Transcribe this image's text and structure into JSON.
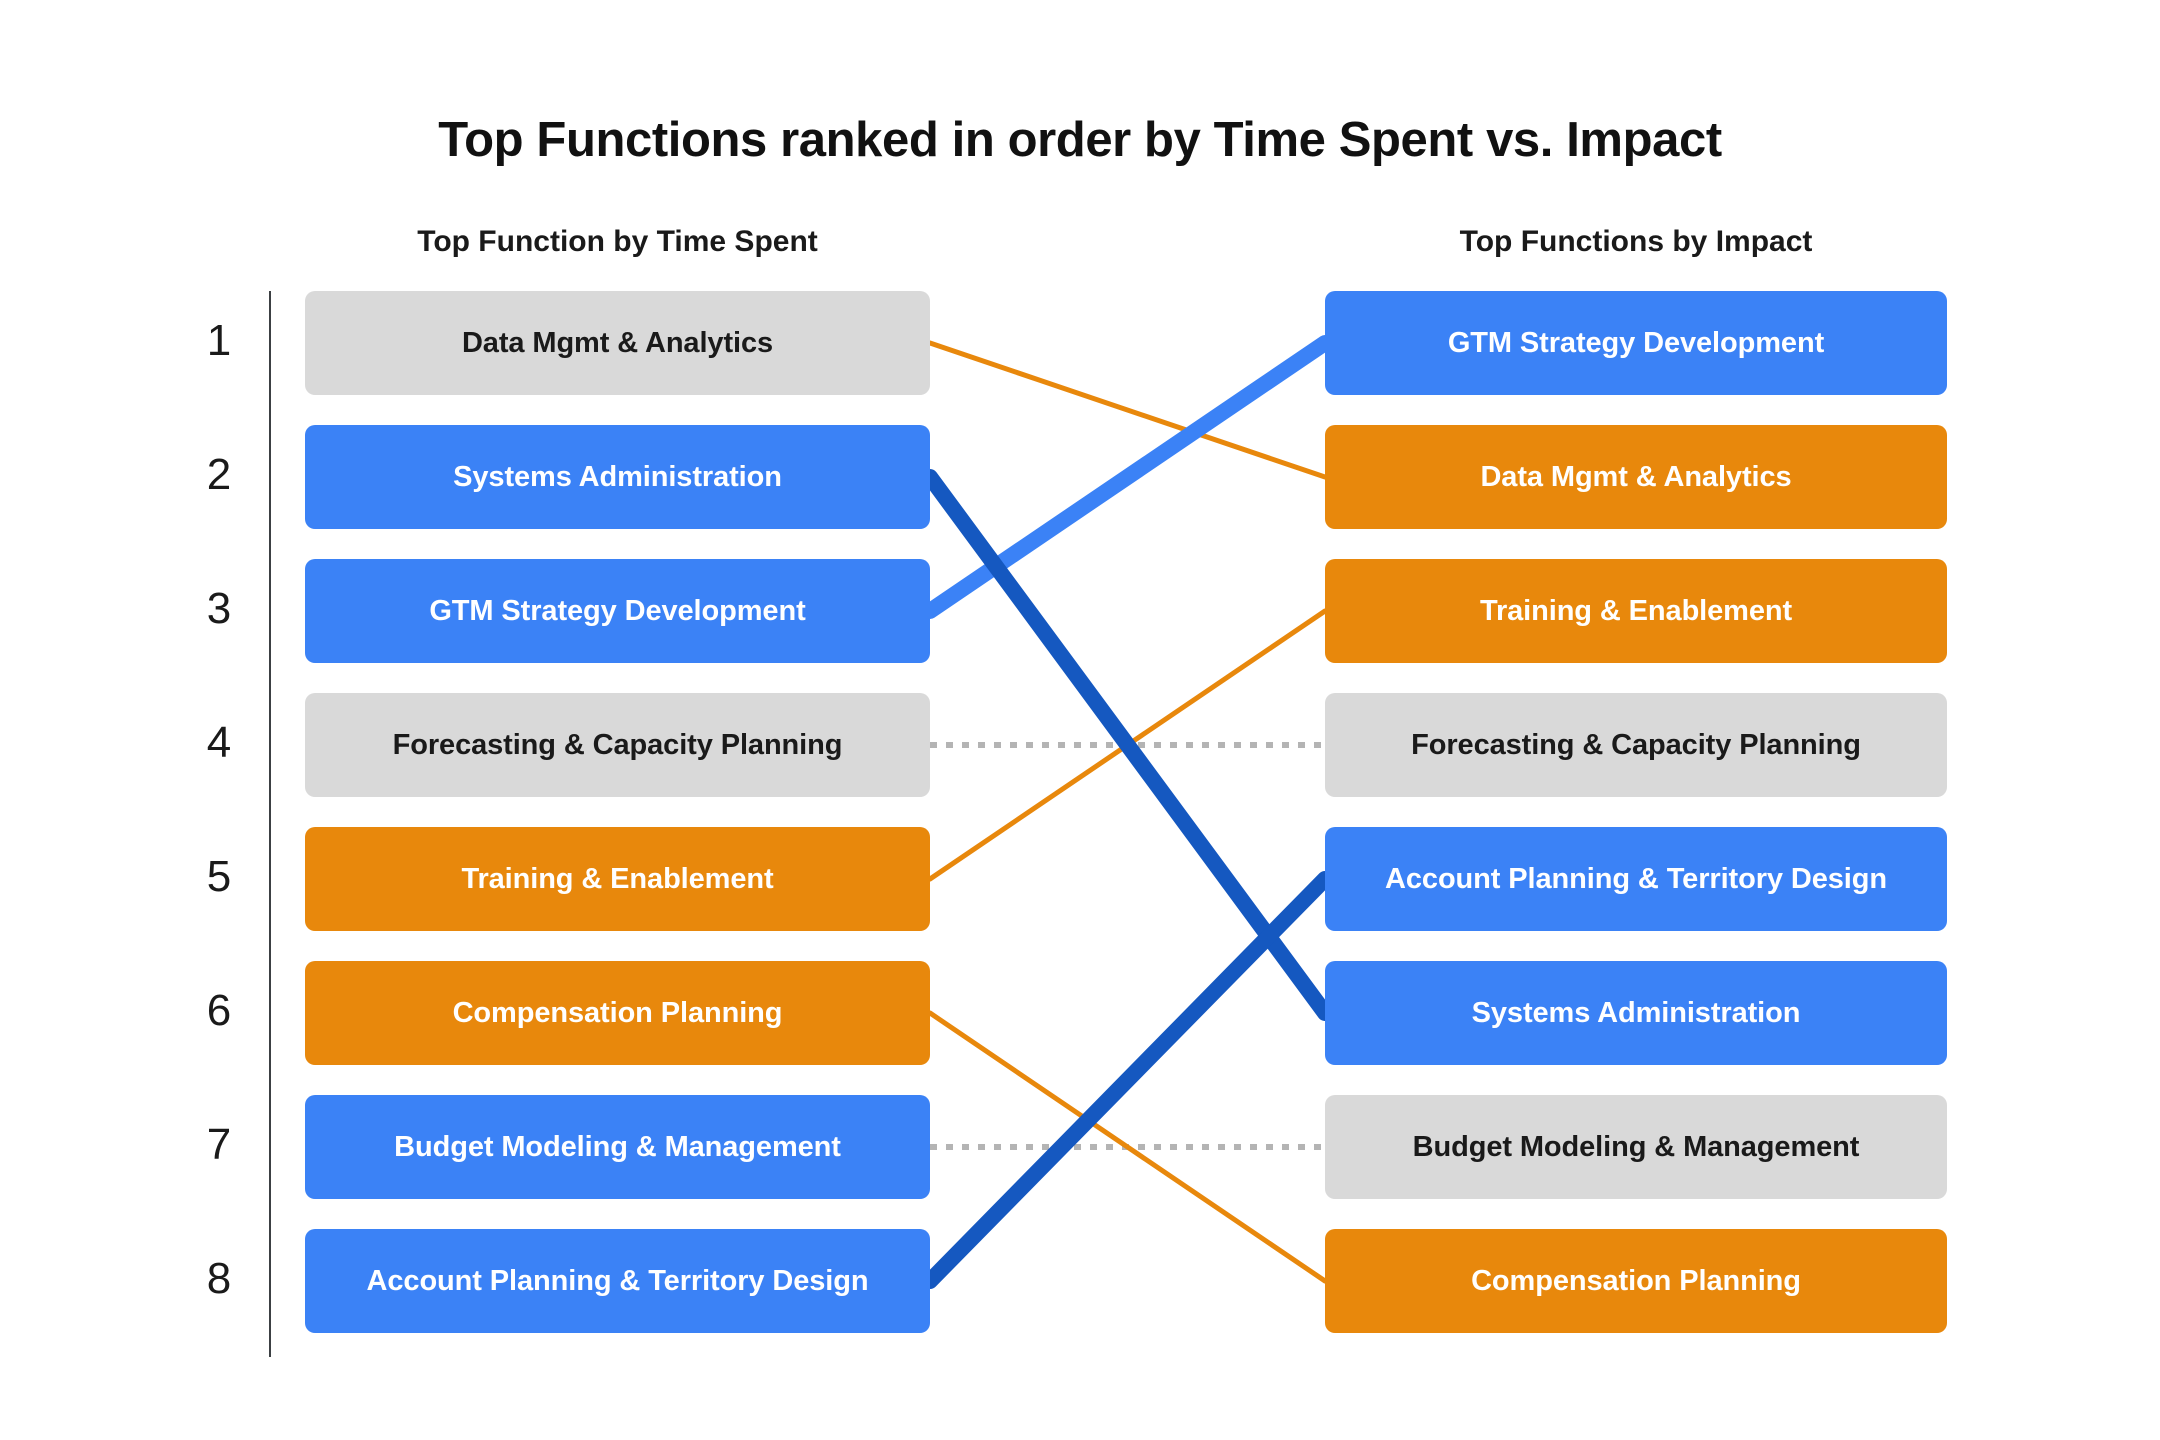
{
  "chart_data": {
    "type": "slope",
    "title": "Top Functions ranked in order by Time Spent vs. Impact",
    "xlabel": "",
    "ylabel": "",
    "grid": false,
    "legend": "none",
    "columns": [
      {
        "key": "time_spent",
        "label": "Top Function by Time Spent"
      },
      {
        "key": "impact",
        "label": "Top Functions by Impact"
      }
    ],
    "ranks": [
      "1",
      "2",
      "3",
      "4",
      "5",
      "6",
      "7",
      "8"
    ],
    "colors": {
      "gray": "#d9d9d9",
      "blue": "#3b82f6",
      "orange": "#e8880c",
      "link_blue_light": "#3b82f6",
      "link_blue_dark": "#1558c0",
      "link_orange": "#e8880c",
      "link_dotted_gray": "#b4b4b4",
      "axis": "#3c4043",
      "title_text": "#111111",
      "dark_text": "#1a1a1a",
      "light_text": "#ffffff"
    },
    "left_column": [
      {
        "rank": "1",
        "label": "Data Mgmt & Analytics",
        "color": "gray"
      },
      {
        "rank": "2",
        "label": "Systems Administration",
        "color": "blue"
      },
      {
        "rank": "3",
        "label": "GTM Strategy Development",
        "color": "blue"
      },
      {
        "rank": "4",
        "label": "Forecasting & Capacity Planning",
        "color": "gray"
      },
      {
        "rank": "5",
        "label": "Training & Enablement",
        "color": "orange"
      },
      {
        "rank": "6",
        "label": "Compensation Planning",
        "color": "orange"
      },
      {
        "rank": "7",
        "label": "Budget Modeling & Management",
        "color": "blue"
      },
      {
        "rank": "8",
        "label": "Account Planning & Territory Design",
        "color": "blue"
      }
    ],
    "right_column": [
      {
        "rank": "1",
        "label": "GTM Strategy Development",
        "color": "blue"
      },
      {
        "rank": "2",
        "label": "Data Mgmt & Analytics",
        "color": "orange"
      },
      {
        "rank": "3",
        "label": "Training & Enablement",
        "color": "orange"
      },
      {
        "rank": "4",
        "label": "Forecasting & Capacity Planning",
        "color": "gray"
      },
      {
        "rank": "5",
        "label": "Account Planning & Territory Design",
        "color": "blue"
      },
      {
        "rank": "6",
        "label": "Systems Administration",
        "color": "blue"
      },
      {
        "rank": "7",
        "label": "Budget Modeling & Management",
        "color": "gray"
      },
      {
        "rank": "8",
        "label": "Compensation Planning",
        "color": "orange"
      }
    ],
    "links": [
      {
        "label": "Data Mgmt & Analytics",
        "from_rank": 1,
        "to_rank": 2,
        "style": "orange-thin"
      },
      {
        "label": "Systems Administration",
        "from_rank": 2,
        "to_rank": 6,
        "style": "blue-dark-thick"
      },
      {
        "label": "GTM Strategy Development",
        "from_rank": 3,
        "to_rank": 1,
        "style": "blue-light-thick"
      },
      {
        "label": "Forecasting & Capacity Planning",
        "from_rank": 4,
        "to_rank": 4,
        "style": "gray-dotted"
      },
      {
        "label": "Training & Enablement",
        "from_rank": 5,
        "to_rank": 3,
        "style": "orange-thin"
      },
      {
        "label": "Compensation Planning",
        "from_rank": 6,
        "to_rank": 8,
        "style": "orange-thin"
      },
      {
        "label": "Budget Modeling & Management",
        "from_rank": 7,
        "to_rank": 7,
        "style": "gray-dotted"
      },
      {
        "label": "Account Planning & Territory Design",
        "from_rank": 8,
        "to_rank": 5,
        "style": "blue-dark-thick"
      }
    ]
  }
}
